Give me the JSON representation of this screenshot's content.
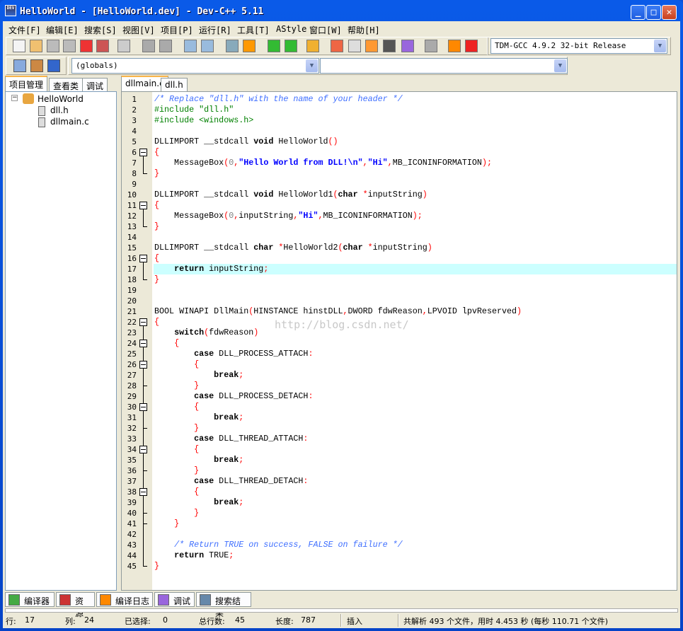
{
  "window": {
    "title": "HelloWorld - [HelloWorld.dev] - Dev-C++ 5.11",
    "app_icon": "devcpp-icon"
  },
  "menu": [
    "文件[F]",
    "编辑[E]",
    "搜索[S]",
    "视图[V]",
    "项目[P]",
    "运行[R]",
    "工具[T]",
    "AStyle",
    "窗口[W]",
    "帮助[H]"
  ],
  "toolbar": {
    "compiler_select": "TDM-GCC 4.9.2 32-bit Release",
    "scope_select": "(globals)",
    "symbol_select": ""
  },
  "left_tabs": [
    "项目管理",
    "查看类",
    "调试"
  ],
  "tree": {
    "project": "HelloWorld",
    "files": [
      "dll.h",
      "dllmain.c"
    ]
  },
  "editor_tabs": [
    "dllmain.c",
    "dll.h"
  ],
  "highlight_line": 17,
  "fold_ranges": [
    [
      6,
      8
    ],
    [
      11,
      13
    ],
    [
      16,
      18
    ],
    [
      22,
      45
    ],
    [
      24,
      41
    ],
    [
      26,
      28
    ],
    [
      30,
      32
    ],
    [
      34,
      36
    ],
    [
      38,
      40
    ]
  ],
  "code": [
    [
      [
        "c",
        "/* Replace \"dll.h\" with the name of your header */"
      ]
    ],
    [
      [
        "d",
        "#include \"dll.h\""
      ]
    ],
    [
      [
        "d",
        "#include <windows.h>"
      ]
    ],
    [],
    [
      [
        "t",
        "DLLIMPORT __stdcall "
      ],
      [
        "k",
        "void"
      ],
      [
        "t",
        " HelloWorld"
      ],
      [
        "p",
        "()"
      ]
    ],
    [
      [
        "p",
        "{"
      ]
    ],
    [
      [
        "t",
        "    MessageBox"
      ],
      [
        "p",
        "("
      ],
      [
        "n",
        "0"
      ],
      [
        "p",
        ","
      ],
      [
        "s",
        "\"Hello World from DLL!\\n\""
      ],
      [
        "p",
        ","
      ],
      [
        "s",
        "\"Hi\""
      ],
      [
        "p",
        ","
      ],
      [
        "t",
        "MB_ICONINFORMATION"
      ],
      [
        "p",
        ");"
      ]
    ],
    [
      [
        "p",
        "}"
      ]
    ],
    [],
    [
      [
        "t",
        "DLLIMPORT __stdcall "
      ],
      [
        "k",
        "void"
      ],
      [
        "t",
        " HelloWorld1"
      ],
      [
        "p",
        "("
      ],
      [
        "k",
        "char"
      ],
      [
        "t",
        " "
      ],
      [
        "p",
        "*"
      ],
      [
        "t",
        "inputString"
      ],
      [
        "p",
        ")"
      ]
    ],
    [
      [
        "p",
        "{"
      ]
    ],
    [
      [
        "t",
        "    MessageBox"
      ],
      [
        "p",
        "("
      ],
      [
        "n",
        "0"
      ],
      [
        "p",
        ","
      ],
      [
        "t",
        "inputString"
      ],
      [
        "p",
        ","
      ],
      [
        "s",
        "\"Hi\""
      ],
      [
        "p",
        ","
      ],
      [
        "t",
        "MB_ICONINFORMATION"
      ],
      [
        "p",
        ");"
      ]
    ],
    [
      [
        "p",
        "}"
      ]
    ],
    [],
    [
      [
        "t",
        "DLLIMPORT __stdcall "
      ],
      [
        "k",
        "char"
      ],
      [
        "t",
        " "
      ],
      [
        "p",
        "*"
      ],
      [
        "t",
        "HelloWorld2"
      ],
      [
        "p",
        "("
      ],
      [
        "k",
        "char"
      ],
      [
        "t",
        " "
      ],
      [
        "p",
        "*"
      ],
      [
        "t",
        "inputString"
      ],
      [
        "p",
        ")"
      ]
    ],
    [
      [
        "p",
        "{"
      ]
    ],
    [
      [
        "t",
        "    "
      ],
      [
        "k",
        "return"
      ],
      [
        "t",
        " inputString"
      ],
      [
        "p",
        ";"
      ]
    ],
    [
      [
        "p",
        "}"
      ]
    ],
    [],
    [],
    [
      [
        "t",
        "BOOL WINAPI DllMain"
      ],
      [
        "p",
        "("
      ],
      [
        "t",
        "HINSTANCE hinstDLL"
      ],
      [
        "p",
        ","
      ],
      [
        "t",
        "DWORD fdwReason"
      ],
      [
        "p",
        ","
      ],
      [
        "t",
        "LPVOID lpvReserved"
      ],
      [
        "p",
        ")"
      ]
    ],
    [
      [
        "p",
        "{"
      ]
    ],
    [
      [
        "t",
        "    "
      ],
      [
        "k",
        "switch"
      ],
      [
        "p",
        "("
      ],
      [
        "t",
        "fdwReason"
      ],
      [
        "p",
        ")"
      ]
    ],
    [
      [
        "t",
        "    "
      ],
      [
        "p",
        "{"
      ]
    ],
    [
      [
        "t",
        "        "
      ],
      [
        "k",
        "case"
      ],
      [
        "t",
        " DLL_PROCESS_ATTACH"
      ],
      [
        "p",
        ":"
      ]
    ],
    [
      [
        "t",
        "        "
      ],
      [
        "p",
        "{"
      ]
    ],
    [
      [
        "t",
        "            "
      ],
      [
        "k",
        "break"
      ],
      [
        "p",
        ";"
      ]
    ],
    [
      [
        "t",
        "        "
      ],
      [
        "p",
        "}"
      ]
    ],
    [
      [
        "t",
        "        "
      ],
      [
        "k",
        "case"
      ],
      [
        "t",
        " DLL_PROCESS_DETACH"
      ],
      [
        "p",
        ":"
      ]
    ],
    [
      [
        "t",
        "        "
      ],
      [
        "p",
        "{"
      ]
    ],
    [
      [
        "t",
        "            "
      ],
      [
        "k",
        "break"
      ],
      [
        "p",
        ";"
      ]
    ],
    [
      [
        "t",
        "        "
      ],
      [
        "p",
        "}"
      ]
    ],
    [
      [
        "t",
        "        "
      ],
      [
        "k",
        "case"
      ],
      [
        "t",
        " DLL_THREAD_ATTACH"
      ],
      [
        "p",
        ":"
      ]
    ],
    [
      [
        "t",
        "        "
      ],
      [
        "p",
        "{"
      ]
    ],
    [
      [
        "t",
        "            "
      ],
      [
        "k",
        "break"
      ],
      [
        "p",
        ";"
      ]
    ],
    [
      [
        "t",
        "        "
      ],
      [
        "p",
        "}"
      ]
    ],
    [
      [
        "t",
        "        "
      ],
      [
        "k",
        "case"
      ],
      [
        "t",
        " DLL_THREAD_DETACH"
      ],
      [
        "p",
        ":"
      ]
    ],
    [
      [
        "t",
        "        "
      ],
      [
        "p",
        "{"
      ]
    ],
    [
      [
        "t",
        "            "
      ],
      [
        "k",
        "break"
      ],
      [
        "p",
        ";"
      ]
    ],
    [
      [
        "t",
        "        "
      ],
      [
        "p",
        "}"
      ]
    ],
    [
      [
        "t",
        "    "
      ],
      [
        "p",
        "}"
      ]
    ],
    [],
    [
      [
        "t",
        "    "
      ],
      [
        "c",
        "/* Return TRUE on success, FALSE on failure */"
      ]
    ],
    [
      [
        "t",
        "    "
      ],
      [
        "k",
        "return"
      ],
      [
        "t",
        " TRUE"
      ],
      [
        "p",
        ";"
      ]
    ],
    [
      [
        "p",
        "}"
      ]
    ]
  ],
  "watermark": "http://blog.csdn.net/",
  "bottom_tabs": [
    {
      "label": "编译器",
      "icon": "compiler-grid-icon"
    },
    {
      "label": "资源",
      "icon": "resources-icon"
    },
    {
      "label": "编译日志",
      "icon": "bar-chart-icon"
    },
    {
      "label": "调试",
      "icon": "checkmark-icon"
    },
    {
      "label": "搜索结果",
      "icon": "search-results-icon"
    }
  ],
  "status": {
    "row_label": "行:",
    "row": "17",
    "col_label": "列:",
    "col": "24",
    "sel_label": "已选择:",
    "sel": "0",
    "total_label": "总行数:",
    "total": "45",
    "len_label": "长度:",
    "len": "787",
    "mode": "插入",
    "parse": "共解析 493 个文件，用时 4.453 秒 (每秒 110.71 个文件)"
  }
}
